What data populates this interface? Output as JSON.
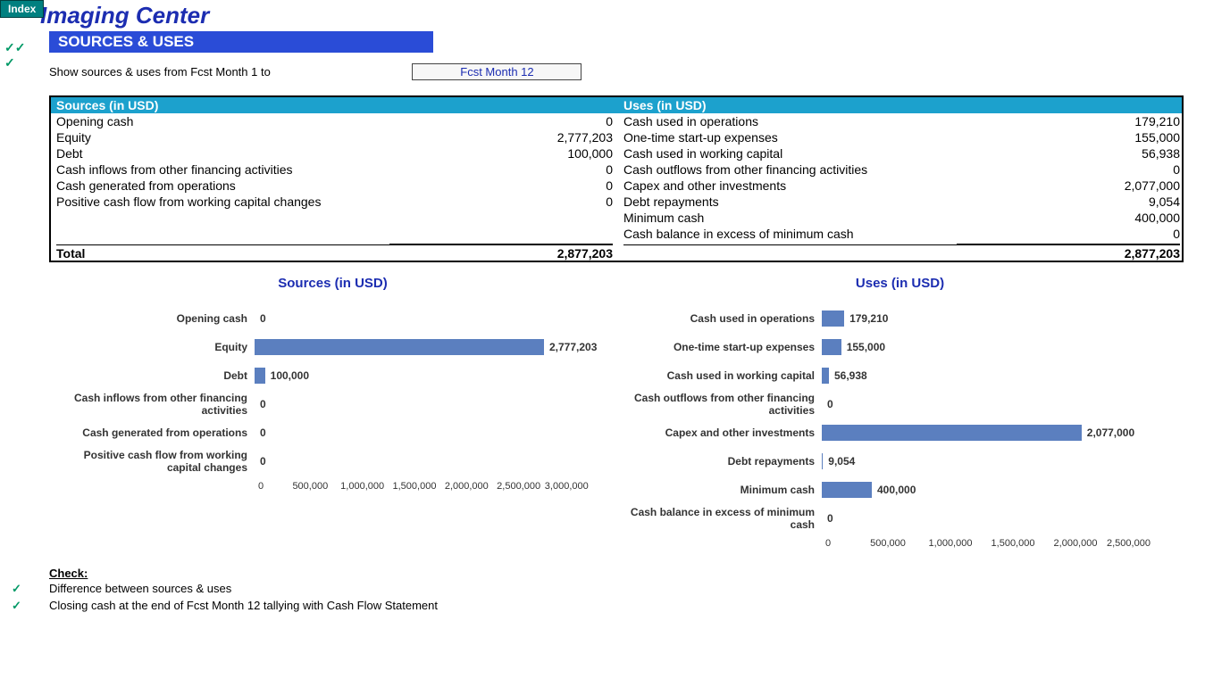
{
  "index_tab": "Index",
  "title": "Imaging Center",
  "section": "SOURCES & USES",
  "prompt": "Show sources & uses from Fcst Month 1 to",
  "dropdown_value": "Fcst Month 12",
  "table": {
    "sources_header": "Sources (in USD)",
    "uses_header": "Uses (in USD)",
    "total_label": "Total",
    "sources_total": "2,877,203",
    "uses_total": "2,877,203",
    "sources": [
      {
        "label": "Opening cash",
        "value": "0"
      },
      {
        "label": "Equity",
        "value": "2,777,203"
      },
      {
        "label": "Debt",
        "value": "100,000"
      },
      {
        "label": "Cash inflows from other financing activities",
        "value": "0"
      },
      {
        "label": "Cash generated from operations",
        "value": "0"
      },
      {
        "label": "Positive cash flow from working capital changes",
        "value": "0"
      }
    ],
    "uses": [
      {
        "label": "Cash used in operations",
        "value": "179,210"
      },
      {
        "label": "One-time start-up expenses",
        "value": "155,000"
      },
      {
        "label": "Cash used in working capital",
        "value": "56,938"
      },
      {
        "label": "Cash outflows from other  financing activities",
        "value": "0"
      },
      {
        "label": "Capex and other investments",
        "value": "2,077,000"
      },
      {
        "label": "Debt repayments",
        "value": "9,054"
      },
      {
        "label": "Minimum cash",
        "value": "400,000"
      },
      {
        "label": "Cash balance in excess of minimum cash",
        "value": "0"
      }
    ]
  },
  "checks": {
    "title": "Check:",
    "items": [
      "Difference between sources & uses",
      "Closing cash at the end of Fcst Month 12 tallying with Cash Flow Statement"
    ]
  },
  "chart_data": [
    {
      "type": "bar",
      "orientation": "horizontal",
      "title": "Sources (in USD)",
      "categories": [
        "Opening cash",
        "Equity",
        "Debt",
        "Cash inflows from other financing activities",
        "Cash generated from operations",
        "Positive cash flow from working capital changes"
      ],
      "values": [
        0,
        2777203,
        100000,
        0,
        0,
        0
      ],
      "xlim": [
        0,
        3000000
      ],
      "ticks": [
        "0",
        "500,000",
        "1,000,000",
        "1,500,000",
        "2,000,000",
        "2,500,000",
        "3,000,000"
      ]
    },
    {
      "type": "bar",
      "orientation": "horizontal",
      "title": "Uses (in USD)",
      "categories": [
        "Cash used in operations",
        "One-time start-up expenses",
        "Cash used in working capital",
        "Cash outflows from other  financing activities",
        "Capex and other investments",
        "Debt repayments",
        "Minimum cash",
        "Cash balance in excess of minimum cash"
      ],
      "values": [
        179210,
        155000,
        56938,
        0,
        2077000,
        9054,
        400000,
        0
      ],
      "xlim": [
        0,
        2500000
      ],
      "ticks": [
        "0",
        "500,000",
        "1,000,000",
        "1,500,000",
        "2,000,000",
        "2,500,000"
      ]
    }
  ]
}
